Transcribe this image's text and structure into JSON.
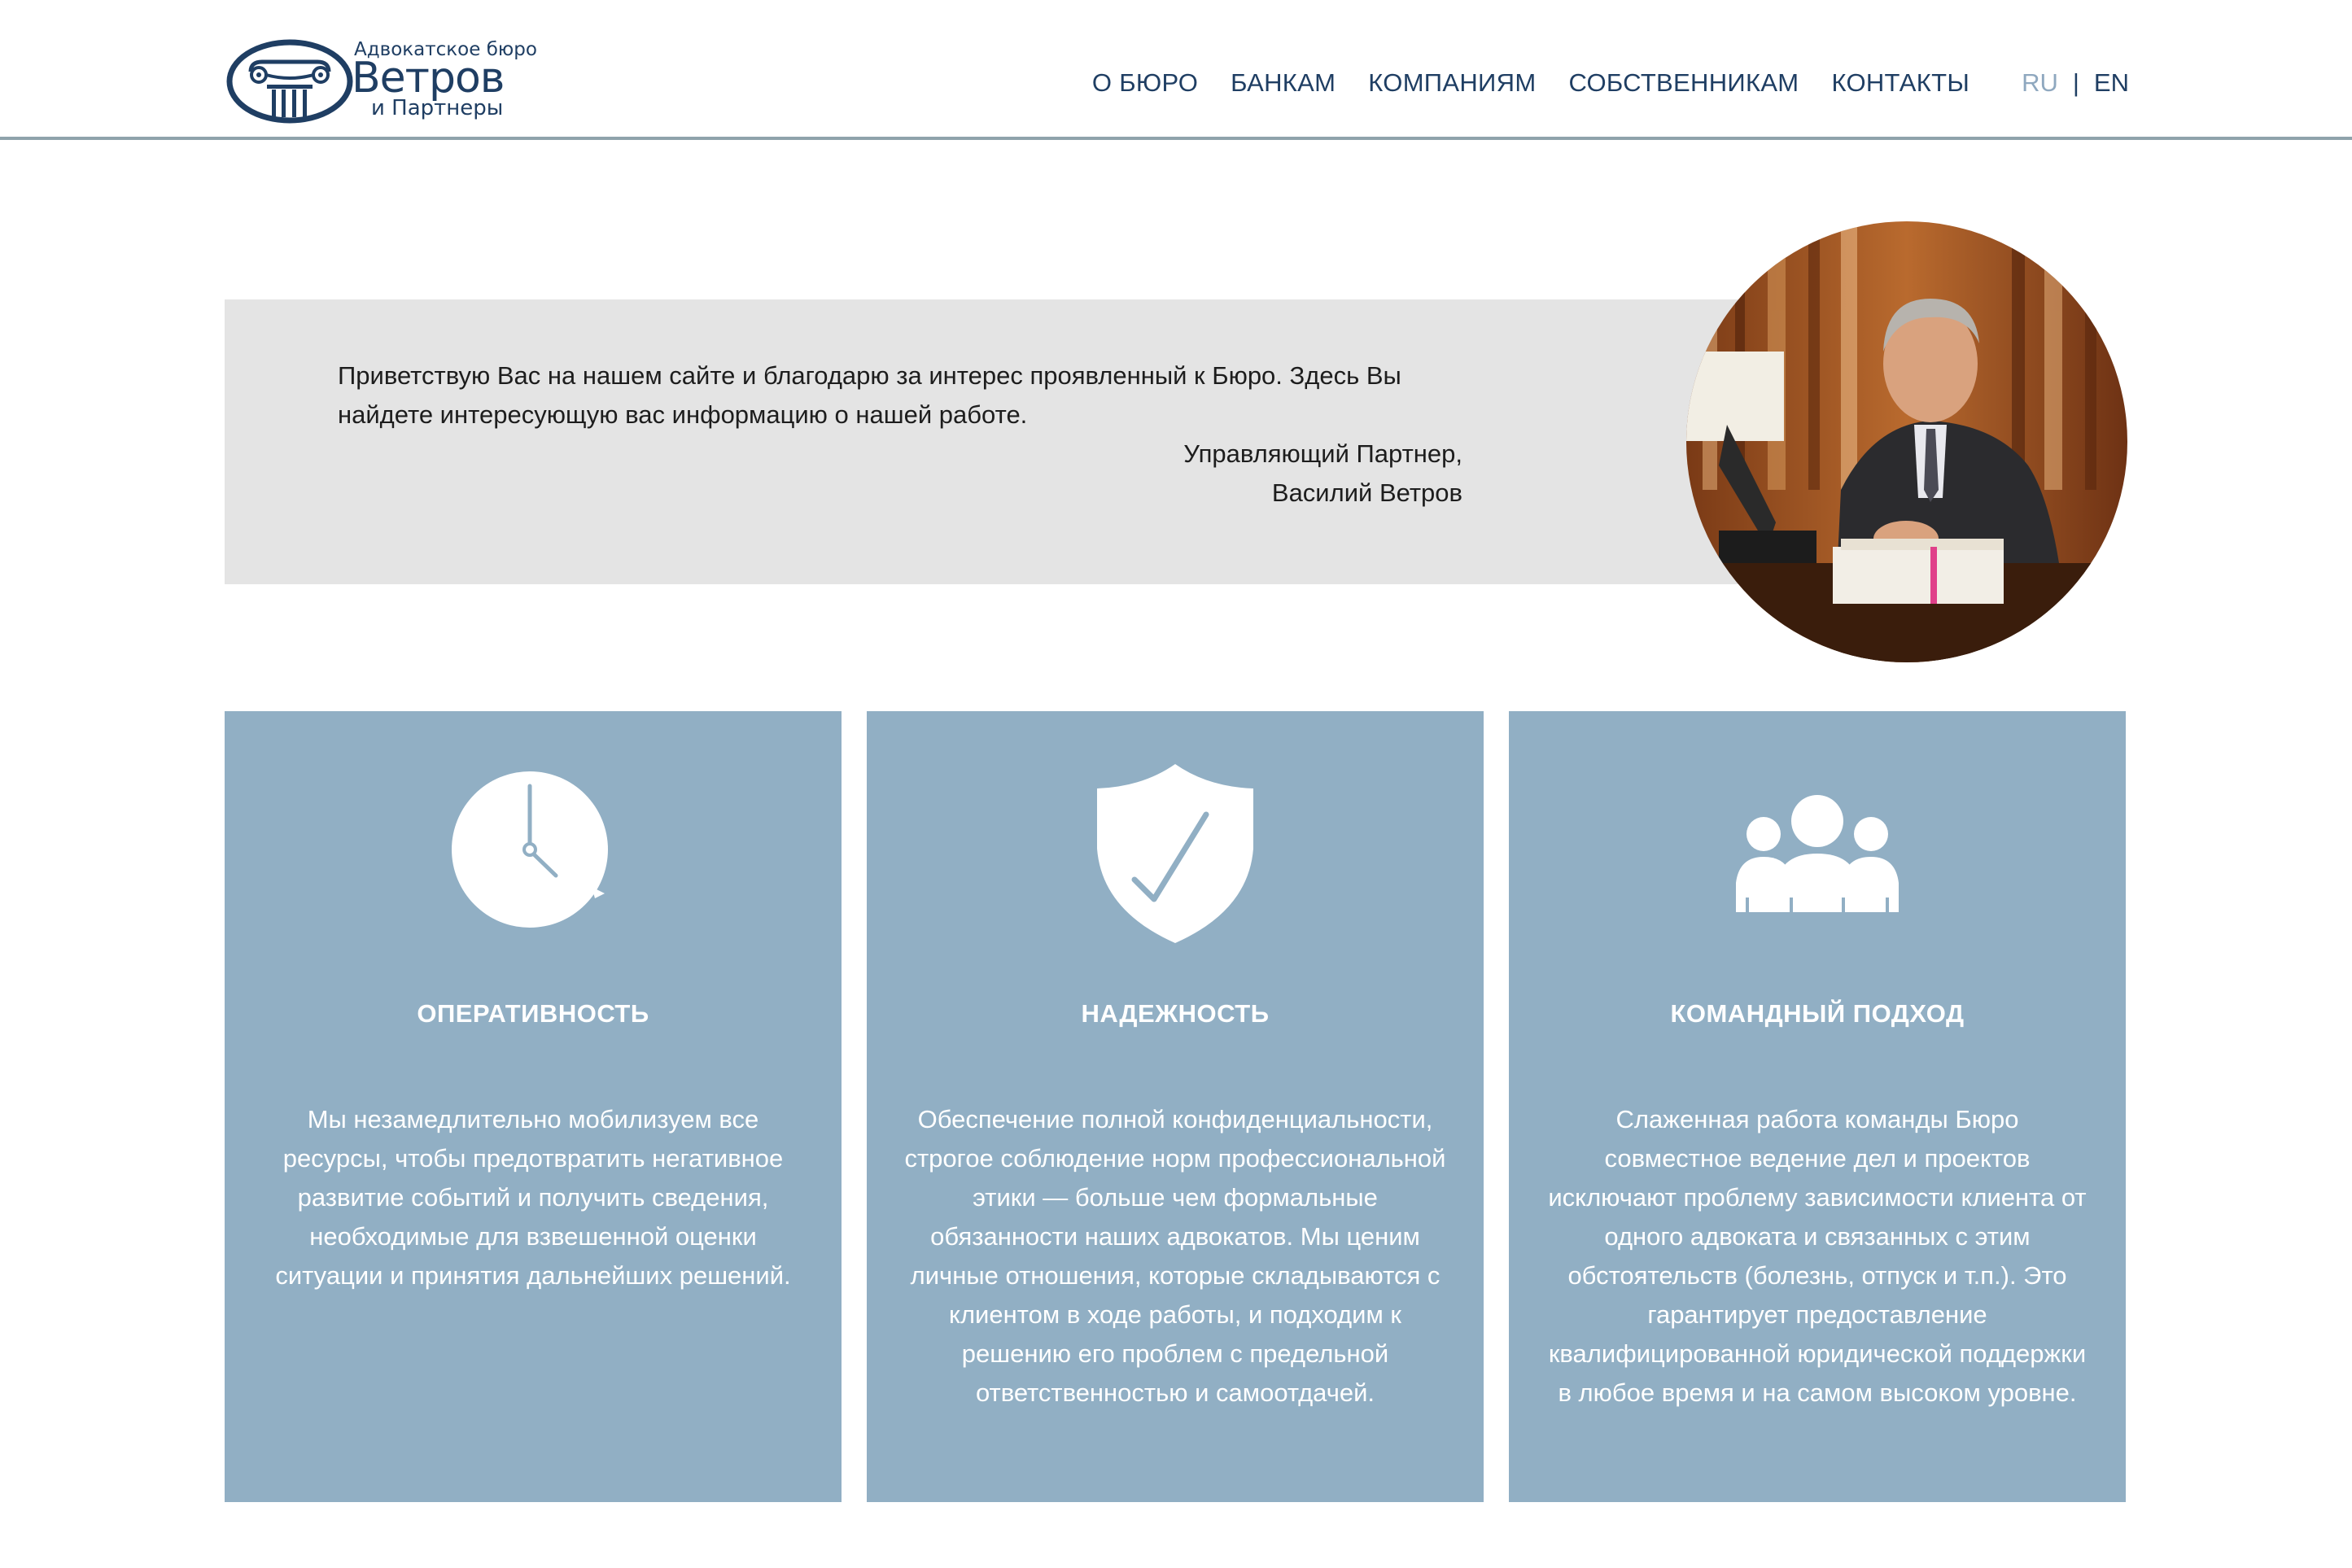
{
  "header": {
    "logo": {
      "small_line": "Адвокатское бюро",
      "name": "Ветров",
      "sub_line": "и Партнеры"
    },
    "nav": [
      "О БЮРО",
      "БАНКАМ",
      "КОМПАНИЯМ",
      "СОБСТВЕННИКАМ",
      "КОНТАКТЫ"
    ],
    "lang": {
      "ru": "RU",
      "separator": "|",
      "en": "EN",
      "active": "RU"
    }
  },
  "welcome": {
    "text": "Приветствую Вас на нашем сайте и благодарю за интерес проявленный к Бюро. Здесь Вы найдете интересующую вас информацию о нашей работе.",
    "signature_role": "Управляющий Партнер,",
    "signature_name": "Василий Ветров"
  },
  "features": [
    {
      "icon": "clock-icon",
      "title": "ОПЕРАТИВНОСТЬ",
      "text": "Мы незамедлительно мобилизуем все ресурсы, чтобы предотвратить негативное развитие событий и получить сведения, необходимые для взвешенной оценки ситуации и принятия дальнейших решений."
    },
    {
      "icon": "shield-check-icon",
      "title": "НАДЕЖНОСТЬ",
      "text": "Обеспечение полной конфиденциальности, строгое соблюдение норм профессиональной этики — больше чем формальные обязанности наших адвокатов. Мы ценим личные отношения, которые складываются с клиентом в ходе работы, и подходим к решению его проблем с предельной ответственностью и самоотдачей."
    },
    {
      "icon": "team-icon",
      "title": "КОМАНДНЫЙ ПОДХОД",
      "text": "Слаженная работа команды Бюро совместное ведение дел и проектов исключают проблему зависимости клиента от одного адвоката и связанных с этим обстоятельств (болезнь, отпуск и т.п.). Это гарантирует предоставление квалифицированной юридической поддержки в любое время и на самом высоком уровне."
    }
  ],
  "colors": {
    "brand": "#1f3e63",
    "card_background": "#91afc4",
    "welcome_background": "#e4e4e4",
    "header_border": "#8fa3ab",
    "lang_inactive": "#8fa8bf"
  }
}
